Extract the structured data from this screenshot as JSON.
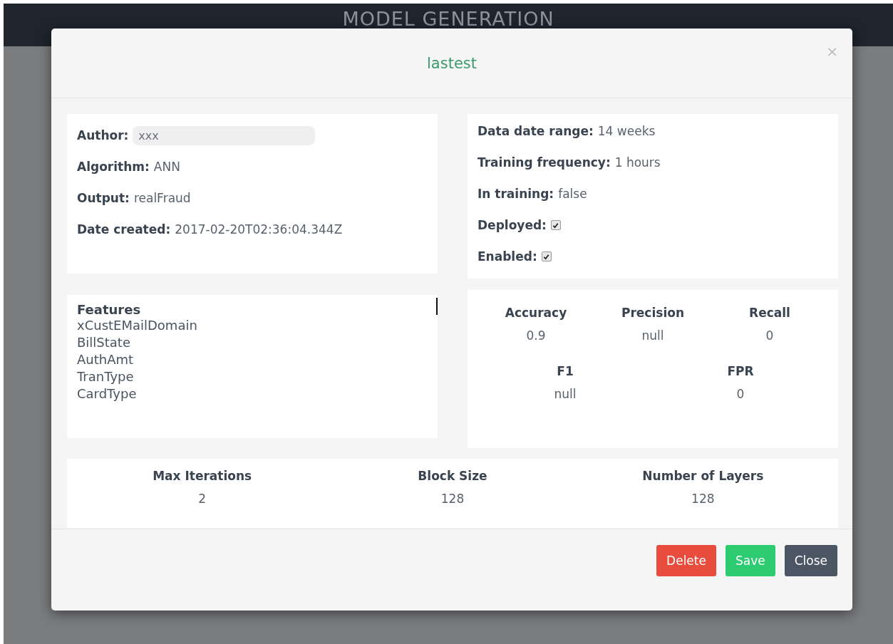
{
  "page": {
    "title": "MODEL GENERATION"
  },
  "modal": {
    "title": "lastest",
    "close": "×",
    "left_info": [
      {
        "kind": "field",
        "label": "Author:",
        "value": "xxx"
      },
      {
        "kind": "text",
        "label": "Algorithm:",
        "value": "ANN"
      },
      {
        "kind": "text",
        "label": "Output:",
        "value": "realFraud"
      },
      {
        "kind": "text",
        "label": "Date created:",
        "value": "2017-02-20T02:36:04.344Z"
      }
    ],
    "right_info": [
      {
        "kind": "text",
        "label": "Data date range:",
        "value": "14 weeks"
      },
      {
        "kind": "text",
        "label": "Training frequency:",
        "value": "1 hours"
      },
      {
        "kind": "text",
        "label": "In training:",
        "value": "false"
      },
      {
        "kind": "checkbox",
        "label": "Deployed:",
        "checked": true
      },
      {
        "kind": "checkbox",
        "label": "Enabled:",
        "checked": true
      }
    ],
    "features": {
      "heading": "Features",
      "items": [
        "xCustEMailDomain",
        "BillState",
        "AuthAmt",
        "TranType",
        "CardType"
      ]
    },
    "metrics_top": [
      {
        "label": "Accuracy",
        "value": "0.9"
      },
      {
        "label": "Precision",
        "value": "null"
      },
      {
        "label": "Recall",
        "value": "0"
      }
    ],
    "metrics_bottom": [
      {
        "label": "F1",
        "value": "null"
      },
      {
        "label": "FPR",
        "value": "0"
      }
    ],
    "params": [
      {
        "label": "Max Iterations",
        "value": "2"
      },
      {
        "label": "Block Size",
        "value": "128"
      },
      {
        "label": "Number of Layers",
        "value": "128"
      }
    ],
    "buttons": [
      {
        "kind": "danger",
        "label": "Delete"
      },
      {
        "kind": "success",
        "label": "Save"
      },
      {
        "kind": "default",
        "label": "Close"
      }
    ]
  }
}
